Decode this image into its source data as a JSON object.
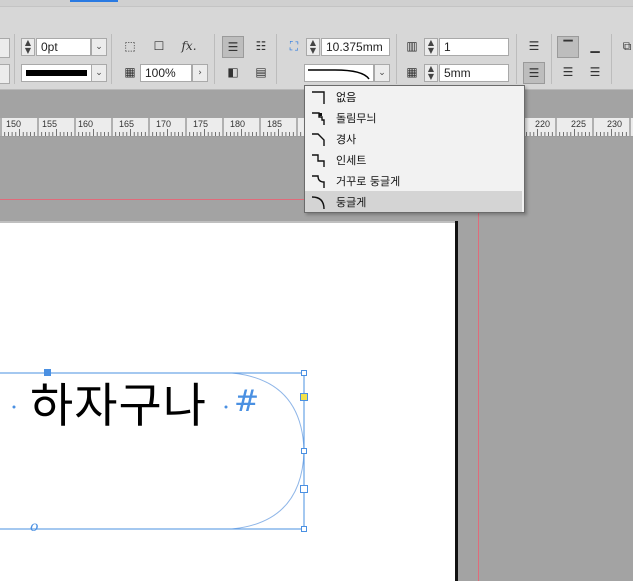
{
  "control_panel": {
    "stroke_weight": "0pt",
    "opacity": "100%",
    "column_width": "10.375mm",
    "column_count": "1",
    "gutter": "5mm",
    "fx_label": "fx."
  },
  "ruler": {
    "ticks": [
      "150",
      "155",
      "160",
      "165",
      "170",
      "175",
      "180",
      "185",
      "220",
      "225",
      "230"
    ]
  },
  "corner_menu": {
    "items": [
      {
        "label": "없음",
        "icon": "corner-none-icon"
      },
      {
        "label": "돌림무늬",
        "icon": "corner-fancy-icon"
      },
      {
        "label": "경사",
        "icon": "corner-bevel-icon"
      },
      {
        "label": "인세트",
        "icon": "corner-inset-icon"
      },
      {
        "label": "거꾸로 둥글게",
        "icon": "corner-inverse-rounded-icon"
      },
      {
        "label": "둥글게",
        "icon": "corner-rounded-icon"
      }
    ],
    "selected_index": 5
  },
  "document": {
    "headline": "하자구나",
    "end_marker": "#",
    "path_marker": "o"
  },
  "colors": {
    "selection": "#4a90e2",
    "guide": "#e06b7a",
    "pasteboard": "#a3a3a3"
  }
}
